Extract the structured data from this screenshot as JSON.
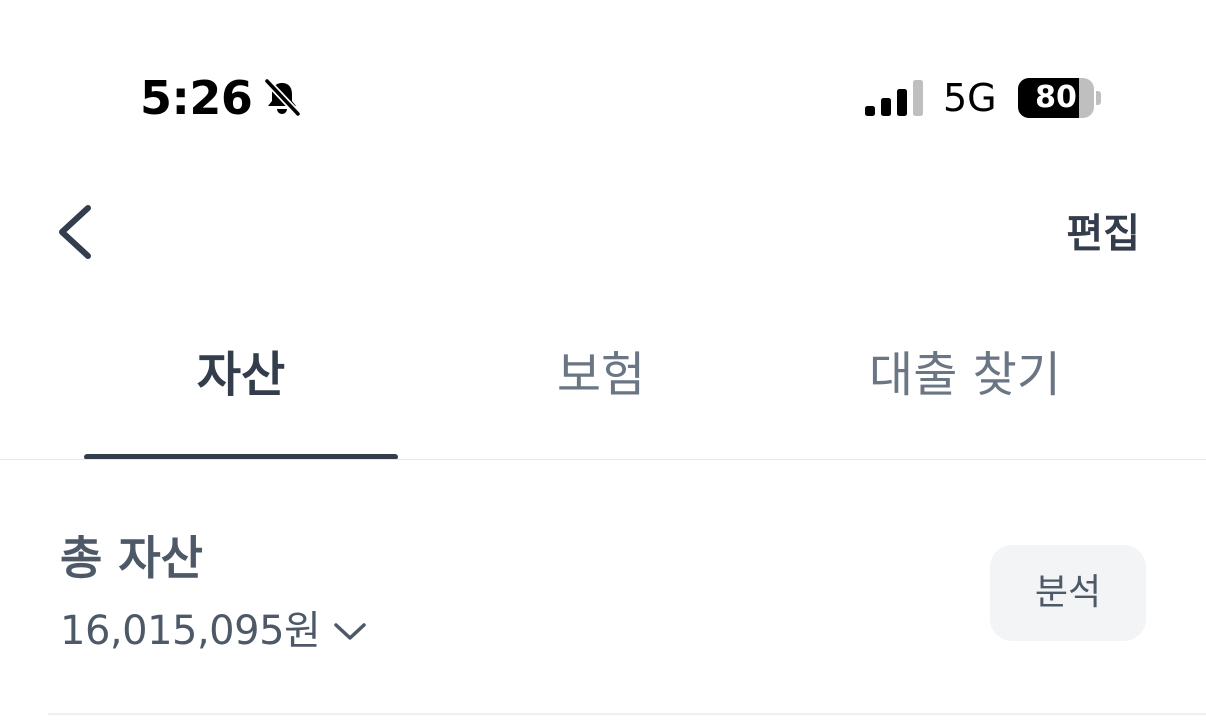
{
  "status_bar": {
    "time": "5:26",
    "silent_icon": "bell-slash-icon",
    "signal_icon": "cellular-signal-icon",
    "network": "5G",
    "battery_level": 80,
    "battery_text": "80"
  },
  "header": {
    "back_icon": "chevron-left-icon",
    "edit_label": "편집"
  },
  "tabs": [
    {
      "label": "자산",
      "active": true
    },
    {
      "label": "보험",
      "active": false
    },
    {
      "label": "대출 찾기",
      "active": false
    }
  ],
  "summary": {
    "title": "총 자산",
    "amount": "16,015,095원",
    "expand_icon": "chevron-down-icon",
    "analysis_label": "분석"
  },
  "colors": {
    "primary_text": "#333d4b",
    "secondary_text": "#6b7684",
    "button_bg": "#f2f4f6"
  }
}
